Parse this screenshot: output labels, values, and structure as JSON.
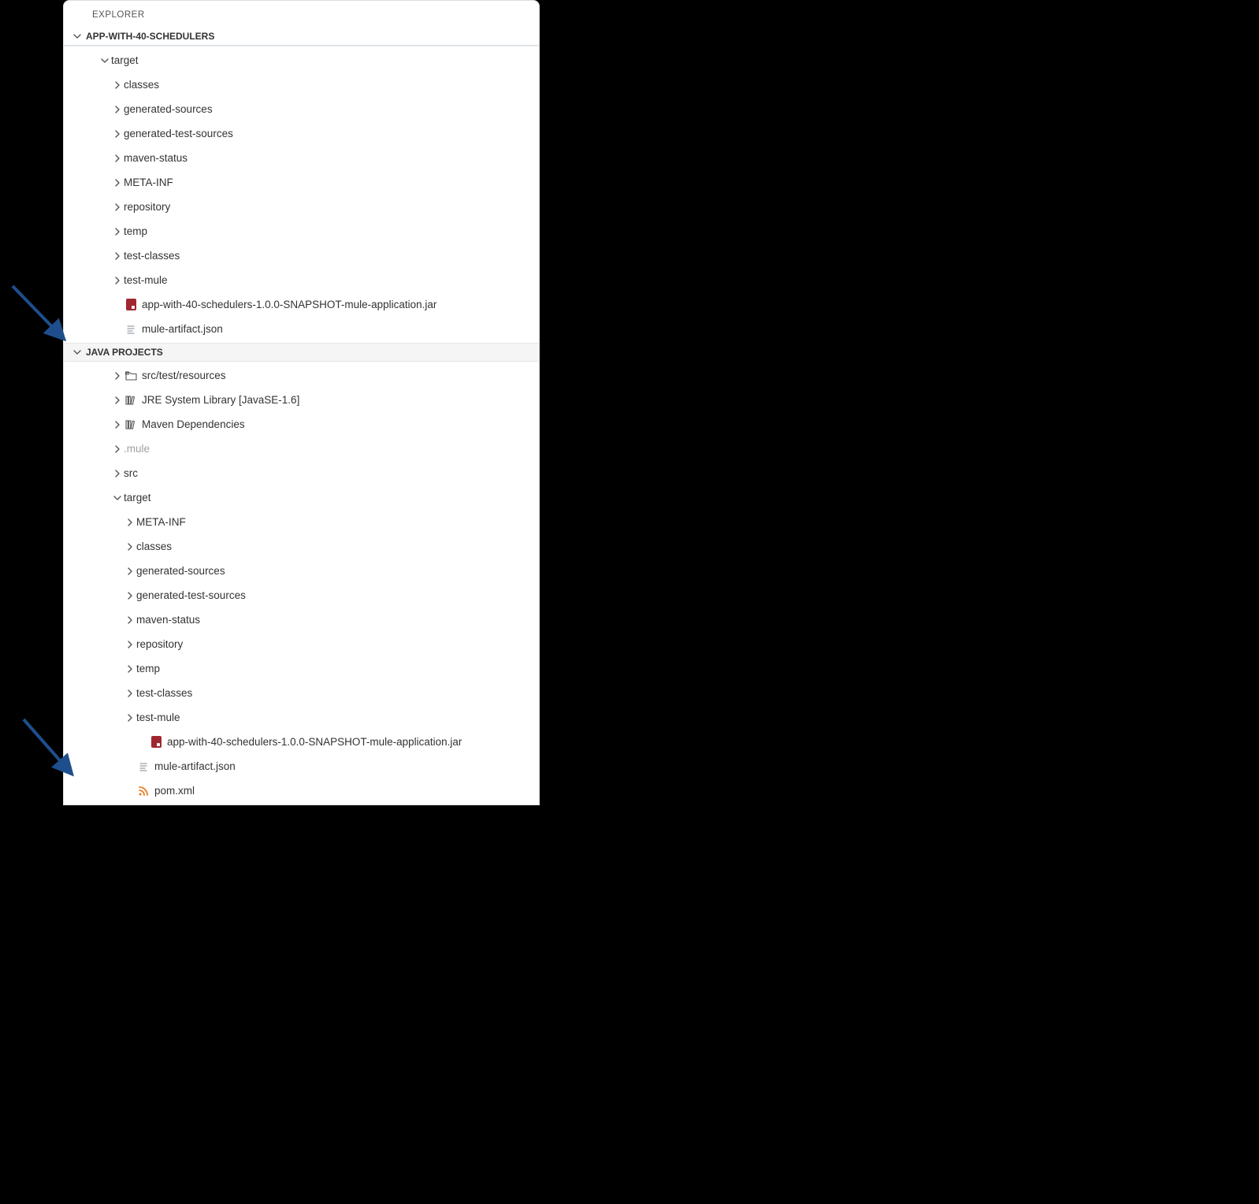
{
  "panel": {
    "title": "EXPLORER"
  },
  "sections": {
    "project": {
      "title": "APP-WITH-40-SCHEDULERS",
      "root": {
        "label": "target",
        "children": [
          {
            "label": "classes"
          },
          {
            "label": "generated-sources"
          },
          {
            "label": "generated-test-sources"
          },
          {
            "label": "maven-status"
          },
          {
            "label": "META-INF"
          },
          {
            "label": "repository"
          },
          {
            "label": "temp"
          },
          {
            "label": "test-classes"
          },
          {
            "label": "test-mule"
          }
        ],
        "files": [
          {
            "label": "app-with-40-schedulers-1.0.0-SNAPSHOT-mule-application.jar",
            "icon": "jar"
          },
          {
            "label": "mule-artifact.json",
            "icon": "lines"
          }
        ]
      }
    },
    "java": {
      "title": "JAVA PROJECTS",
      "items": [
        {
          "label": "src/test/resources",
          "icon": "folder-plus",
          "collapsed": true,
          "indent": 1
        },
        {
          "label": "JRE System Library [JavaSE-1.6]",
          "icon": "library",
          "collapsed": true,
          "indent": 1
        },
        {
          "label": "Maven Dependencies",
          "icon": "library",
          "collapsed": true,
          "indent": 1
        },
        {
          "label": ".mule",
          "muted": true,
          "collapsed": true,
          "indent": 1
        },
        {
          "label": "src",
          "collapsed": true,
          "indent": 1
        },
        {
          "label": "target",
          "collapsed": false,
          "indent": 1
        },
        {
          "label": "META-INF",
          "collapsed": true,
          "indent": 2
        },
        {
          "label": "classes",
          "collapsed": true,
          "indent": 2
        },
        {
          "label": "generated-sources",
          "collapsed": true,
          "indent": 2
        },
        {
          "label": "generated-test-sources",
          "collapsed": true,
          "indent": 2
        },
        {
          "label": "maven-status",
          "collapsed": true,
          "indent": 2
        },
        {
          "label": "repository",
          "collapsed": true,
          "indent": 2
        },
        {
          "label": "temp",
          "collapsed": true,
          "indent": 2
        },
        {
          "label": "test-classes",
          "collapsed": true,
          "indent": 2
        },
        {
          "label": "test-mule",
          "collapsed": true,
          "indent": 2
        }
      ],
      "files": [
        {
          "label": "app-with-40-schedulers-1.0.0-SNAPSHOT-mule-application.jar",
          "icon": "jar",
          "indent": 2
        },
        {
          "label": "mule-artifact.json",
          "icon": "lines",
          "indent": 1
        },
        {
          "label": "pom.xml",
          "icon": "rss",
          "indent": 1
        }
      ]
    }
  },
  "annotation_color": "#1e4e8c"
}
